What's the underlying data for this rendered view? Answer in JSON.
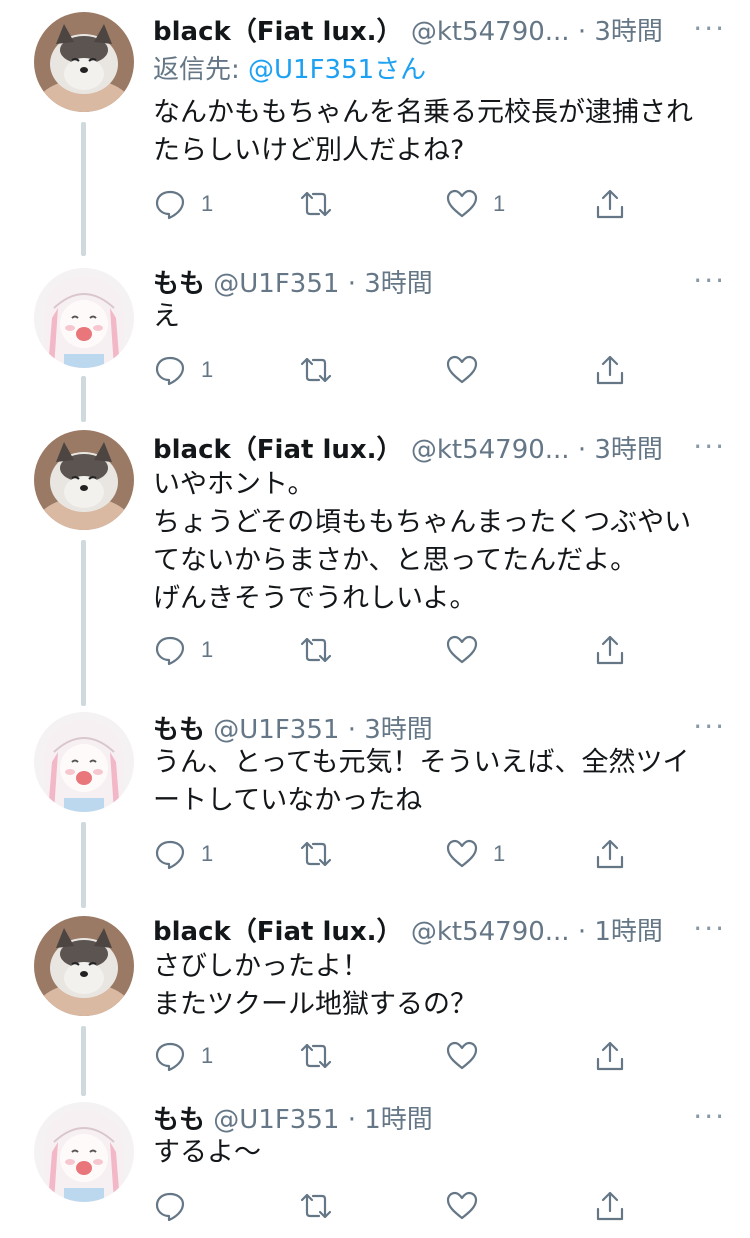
{
  "colors": {
    "text": "#14171a",
    "secondary": "#657786",
    "link": "#1da1f2",
    "thread_line": "#cfd9de"
  },
  "icons": {
    "reply": "comment-bubble",
    "retweet": "retweet-arrows",
    "like": "heart-outline",
    "share": "share-upload",
    "more": "more-dots"
  },
  "tweets": [
    {
      "name": "black（Fiat lux.）",
      "handle": "@kt54790...",
      "sep": "·",
      "time": "3時間",
      "reply_label": "返信先: ",
      "reply_to": "@U1F351さん",
      "lines": [
        "なんかももちゃんを名乗る元校長が逮捕され",
        "たらしいけど別人だよね?"
      ],
      "reply_count": "1",
      "retweet_count": "",
      "like_count": "1",
      "more": "···"
    },
    {
      "name": "もも",
      "handle": "@U1F351",
      "sep": "·",
      "time": "3時間",
      "lines": [
        "え"
      ],
      "reply_count": "1",
      "retweet_count": "",
      "like_count": "",
      "more": "···"
    },
    {
      "name": "black（Fiat lux.）",
      "handle": "@kt54790...",
      "sep": "·",
      "time": "3時間",
      "lines": [
        "いやホント。",
        "ちょうどその頃ももちゃんまったくつぶやい",
        "てないからまさか、と思ってたんだよ。",
        "げんきそうでうれしいよ。"
      ],
      "reply_count": "1",
      "retweet_count": "",
      "like_count": "",
      "more": "···"
    },
    {
      "name": "もも",
      "handle": "@U1F351",
      "sep": "·",
      "time": "3時間",
      "lines": [
        "うん、とっても元気！そういえば、全然ツイ",
        "ートしていなかったね"
      ],
      "reply_count": "1",
      "retweet_count": "",
      "like_count": "1",
      "more": "···"
    },
    {
      "name": "black（Fiat lux.）",
      "handle": "@kt54790...",
      "sep": "·",
      "time": "1時間",
      "lines": [
        "さびしかったよ！",
        "またツクール地獄するの？"
      ],
      "reply_count": "1",
      "retweet_count": "",
      "like_count": "",
      "more": "···"
    },
    {
      "name": "もも",
      "handle": "@U1F351",
      "sep": "·",
      "time": "1時間",
      "lines": [
        "するよ〜"
      ],
      "reply_count": "",
      "retweet_count": "",
      "like_count": "",
      "more": "···"
    }
  ]
}
